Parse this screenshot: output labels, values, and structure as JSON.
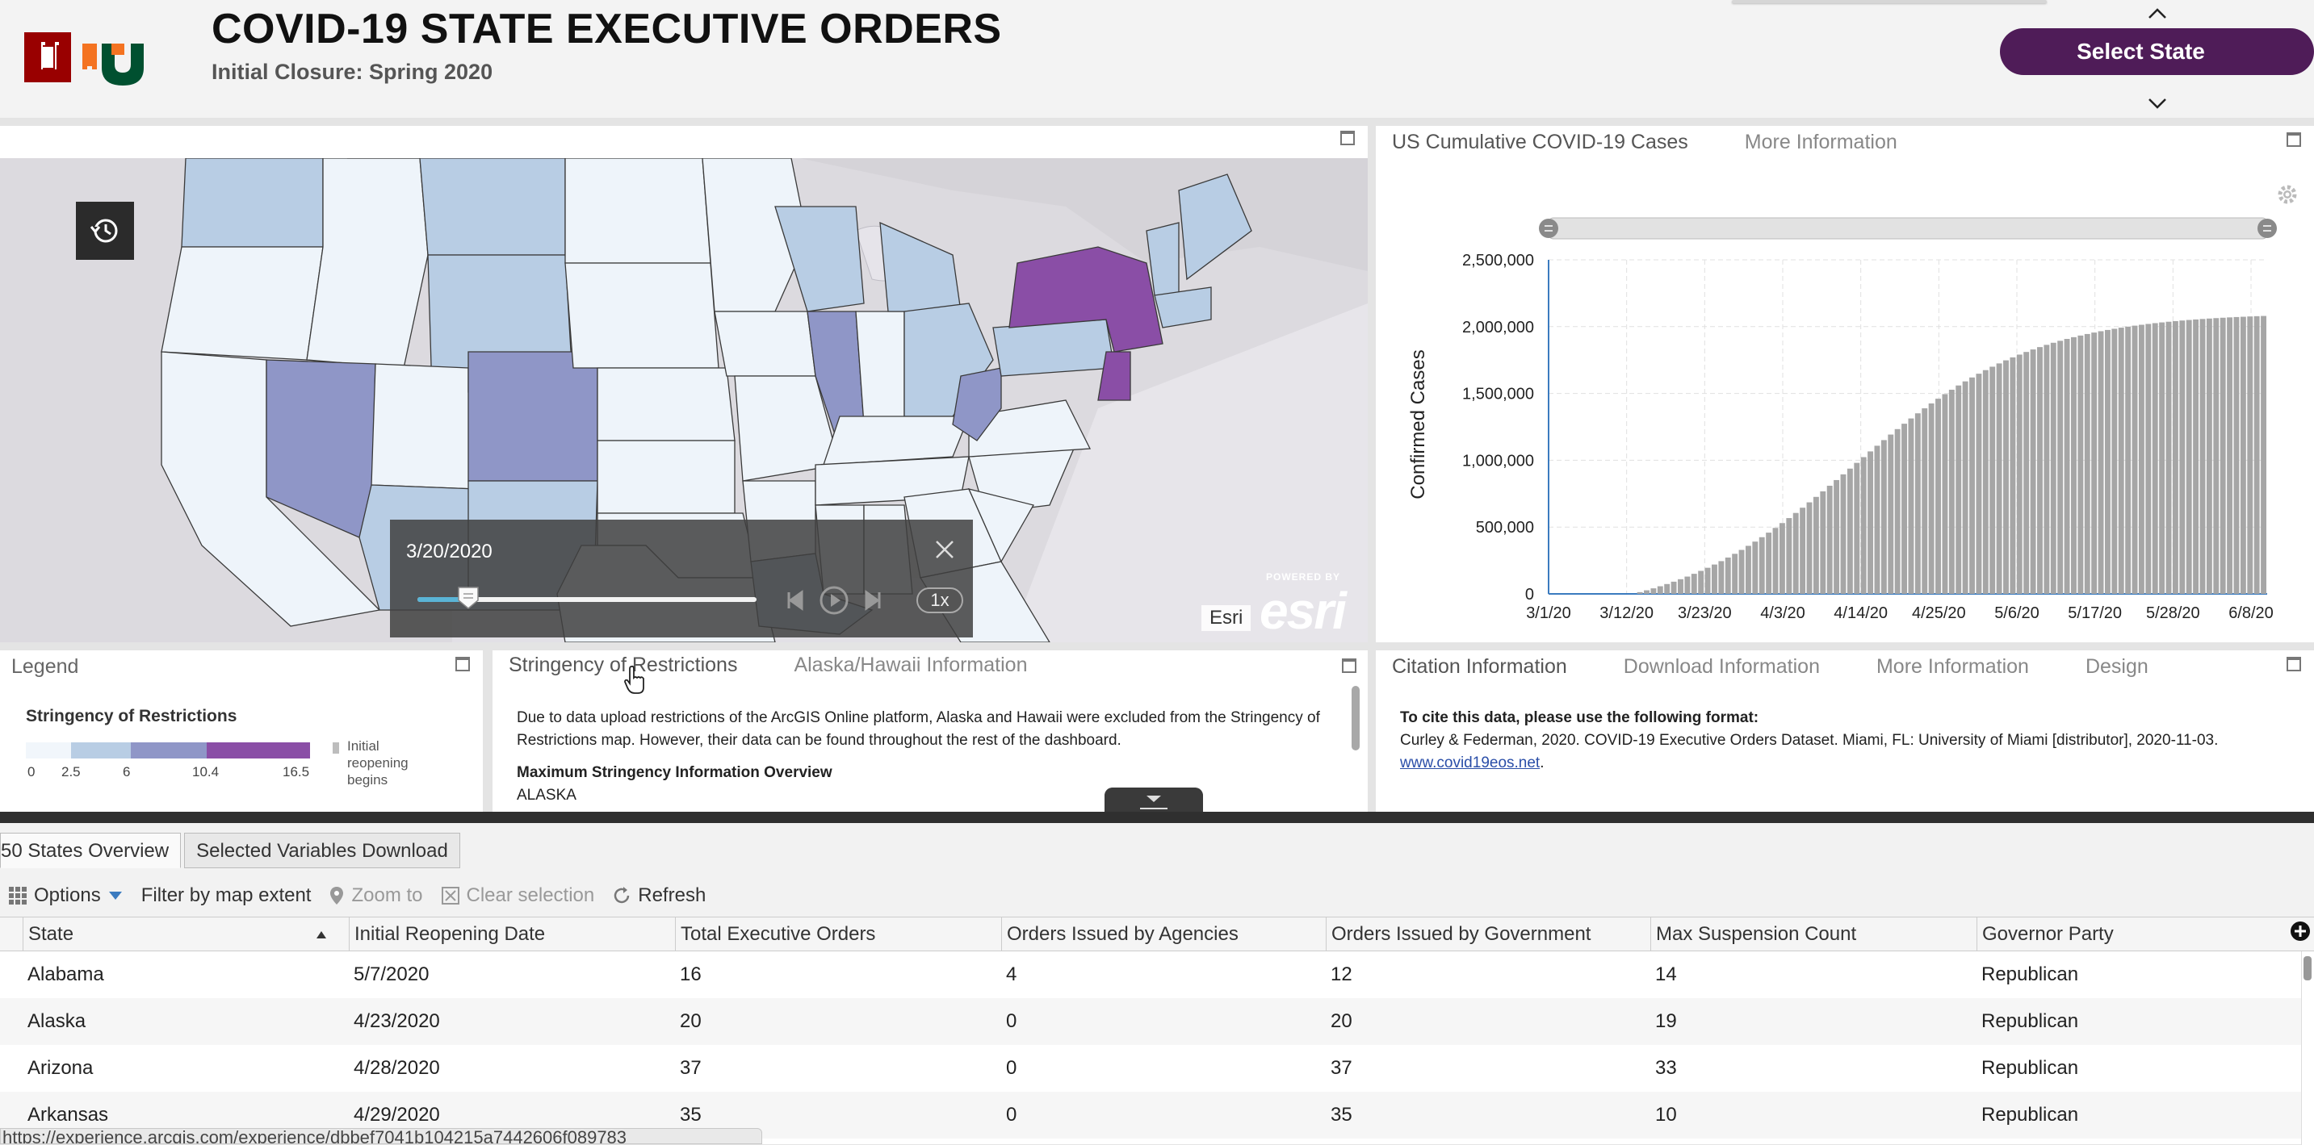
{
  "header": {
    "title": "COVID-19 STATE EXECUTIVE ORDERS",
    "subtitle": "Initial Closure: Spring 2020",
    "select_state_label": "Select State",
    "logo_colors": {
      "iu": "#990000",
      "u_orange": "#f47321",
      "u_green": "#005030"
    }
  },
  "map": {
    "time_slider": {
      "date": "3/20/2020",
      "speed": "1x",
      "progress": 0.15
    },
    "attribution": "Esri",
    "powered_by": "POWERED BY",
    "esri_logo": "esri"
  },
  "chart_panel": {
    "tabs": [
      {
        "label": "US Cumulative COVID-19 Cases"
      },
      {
        "label": "More Information"
      }
    ]
  },
  "chart_data": {
    "type": "bar",
    "title": "",
    "ylabel": "Confirmed Cases",
    "xlabel": "",
    "ylim": [
      0,
      2500000
    ],
    "y_ticks": [
      "2,500,000",
      "2,000,000",
      "1,500,000",
      "1,000,000",
      "500,000",
      "0"
    ],
    "x_ticks": [
      "3/1/20",
      "3/12/20",
      "3/23/20",
      "4/3/20",
      "4/14/20",
      "4/25/20",
      "5/6/20",
      "5/17/20",
      "5/28/20",
      "6/8/20"
    ],
    "start_value": 0,
    "end_value": 2080000,
    "bar_color": "#a6a6a6",
    "grid": true
  },
  "legend_panel": {
    "title": "Legend",
    "subtitle": "Stringency of Restrictions",
    "ticks": [
      "0",
      "2.5",
      "6",
      "10.4",
      "16.5"
    ],
    "colors": [
      "#f1f6fb",
      "#b8cde4",
      "#8f96c7",
      "#8a4ea6"
    ],
    "gray_color": "#bdbdbd",
    "note": "Initial reopening begins"
  },
  "info_panel": {
    "tabs": [
      {
        "label": "Stringency of Restrictions"
      },
      {
        "label": "Alaska/Hawaii Information"
      }
    ],
    "paragraph": "Due to data upload restrictions of the ArcGIS Online platform, Alaska and Hawaii were excluded from the Stringency of Restrictions map. However, their data can be found throughout the rest of the dashboard.",
    "heading": "Maximum Stringency Information Overview",
    "sub": "ALASKA"
  },
  "cite_panel": {
    "tabs": [
      {
        "label": "Citation Information"
      },
      {
        "label": "Download Information"
      },
      {
        "label": "More Information"
      },
      {
        "label": "Design"
      }
    ],
    "lead": "To cite this data, please use the following format:",
    "text": "Curley & Federman, 2020. COVID-19 Executive Orders Dataset. Miami, FL: University of Miami [distributor], 2020-11-03.",
    "link": "www.covid19eos.net",
    "after_link": "."
  },
  "table": {
    "tabs": [
      {
        "label": "50 States Overview"
      },
      {
        "label": "Selected Variables Download"
      }
    ],
    "toolbar": {
      "options": "Options",
      "filter": "Filter by map extent",
      "zoom": "Zoom to",
      "clear": "Clear selection",
      "refresh": "Refresh"
    },
    "columns": [
      "State",
      "Initial Reopening Date",
      "Total Executive Orders",
      "Orders Issued by Agencies",
      "Orders Issued by Government",
      "Max Suspension Count",
      "Governor Party"
    ],
    "rows": [
      [
        "Alabama",
        "5/7/2020",
        "16",
        "4",
        "12",
        "14",
        "Republican"
      ],
      [
        "Alaska",
        "4/23/2020",
        "20",
        "0",
        "20",
        "19",
        "Republican"
      ],
      [
        "Arizona",
        "4/28/2020",
        "37",
        "0",
        "37",
        "33",
        "Republican"
      ],
      [
        "Arkansas",
        "4/29/2020",
        "35",
        "0",
        "35",
        "10",
        "Republican"
      ]
    ]
  },
  "status_bar": {
    "url": "https://experience.arcgis.com/experience/dbbef7041b104215a7442606f089783"
  }
}
